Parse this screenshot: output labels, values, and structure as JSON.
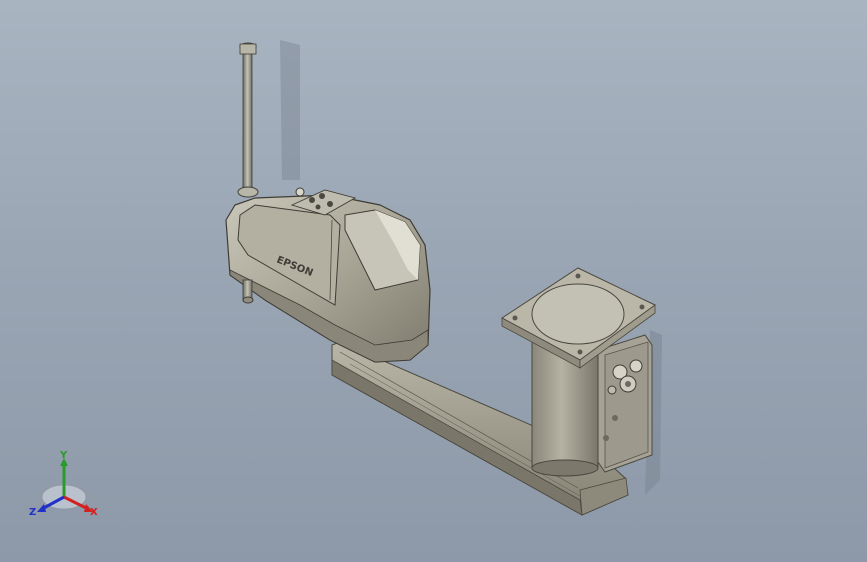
{
  "viewport": {
    "background_top": "#a9b4c1",
    "background_bottom": "#8d99a8"
  },
  "robot": {
    "brand_label": "EPSON",
    "body_color": "#a8a596",
    "column_color": "#9e9b8c",
    "base_color": "#7f7c70"
  },
  "triad": {
    "x_label": "X",
    "y_label": "Y",
    "z_label": "Z",
    "x_color": "#d42020",
    "y_color": "#2a9b2a",
    "z_color": "#2030c8"
  }
}
